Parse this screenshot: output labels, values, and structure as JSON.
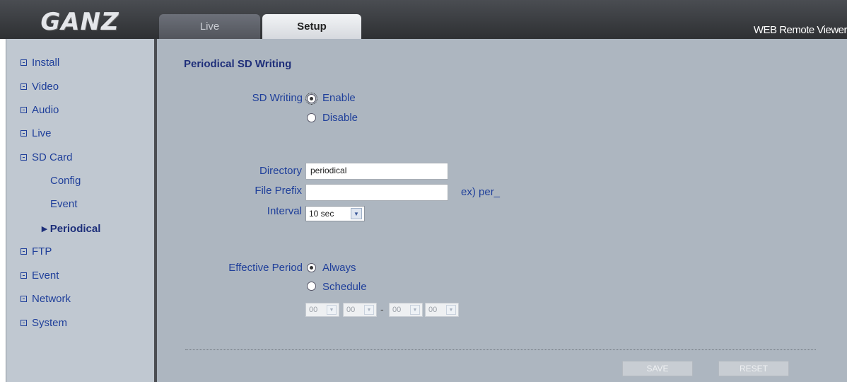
{
  "header": {
    "logo_text": "GANZ",
    "tabs": [
      {
        "label": "Live"
      },
      {
        "label": "Setup"
      }
    ],
    "app_title": "WEB Remote Viewer"
  },
  "sidebar": {
    "items": [
      {
        "label": "Install"
      },
      {
        "label": "Video"
      },
      {
        "label": "Audio"
      },
      {
        "label": "Live"
      },
      {
        "label": "SD Card"
      },
      {
        "label": "FTP"
      },
      {
        "label": "Event"
      },
      {
        "label": "Network"
      },
      {
        "label": "System"
      }
    ],
    "sd_card_sub": [
      {
        "label": "Config"
      },
      {
        "label": "Event"
      },
      {
        "label": "▸ Periodical"
      }
    ]
  },
  "form": {
    "title": "Periodical SD Writing",
    "sd_writing": {
      "label": "SD Writing",
      "options": [
        {
          "label": "Enable",
          "checked": true
        },
        {
          "label": "Disable",
          "checked": false
        }
      ]
    },
    "directory": {
      "label": "Directory",
      "value": "periodical"
    },
    "file_prefix": {
      "label": "File Prefix",
      "value": "",
      "hint": "ex) per_"
    },
    "interval": {
      "label": "Interval",
      "value": "10 sec"
    },
    "effective_period": {
      "label": "Effective Period",
      "options": [
        {
          "label": "Always",
          "checked": true
        },
        {
          "label": "Schedule",
          "checked": false
        }
      ],
      "schedule": {
        "start_hour": "00",
        "start_min": "00",
        "separator": "-",
        "end_hour": "00",
        "end_min": "00"
      }
    },
    "save_label": "SAVE",
    "reset_label": "RESET"
  }
}
